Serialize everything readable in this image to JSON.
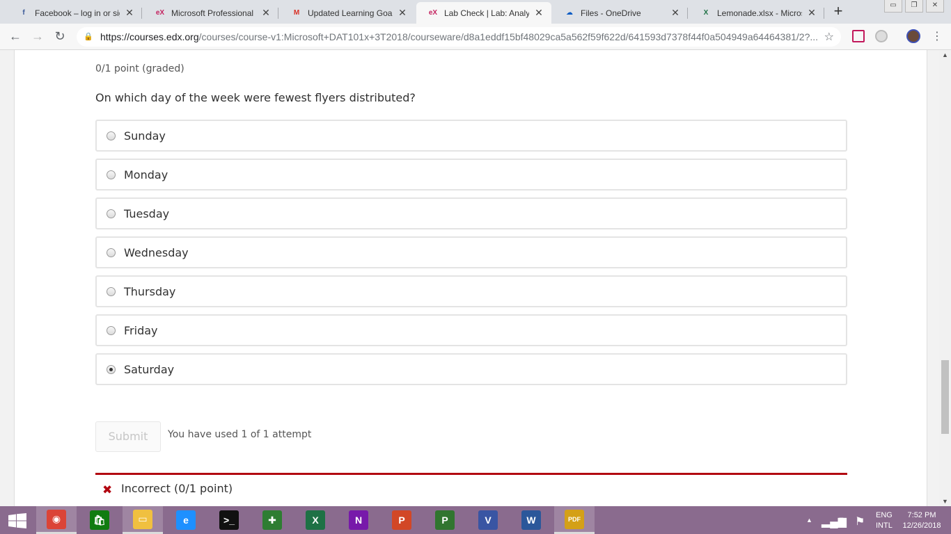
{
  "tabs": [
    {
      "title": "Facebook – log in or sign",
      "icon": "facebook-icon",
      "color": "#3b5998",
      "glyph": "f"
    },
    {
      "title": "Microsoft Professional Pr",
      "icon": "edx-icon",
      "color": "#c4225f",
      "glyph": "eX"
    },
    {
      "title": "Updated Learning Goals",
      "icon": "gmail-icon",
      "color": "#d93025",
      "glyph": "M"
    },
    {
      "title": "Lab Check | Lab: Analyzin",
      "icon": "edx-icon",
      "color": "#c4225f",
      "glyph": "eX"
    },
    {
      "title": "Files - OneDrive",
      "icon": "onedrive-icon",
      "color": "#0a5bc4",
      "glyph": "☁"
    },
    {
      "title": "Lemonade.xlsx - Microso",
      "icon": "excel-icon",
      "color": "#1e7145",
      "glyph": "X"
    }
  ],
  "url": {
    "host": "https://courses.edx.org",
    "path": "/courses/course-v1:Microsoft+DAT101x+3T2018/courseware/d8a1eddf15bf48029ca5a562f59f622d/641593d7378f44f0a504949a64464381/2?..."
  },
  "problem": {
    "grade": "0/1 point (graded)",
    "question": "On which day of the week were fewest flyers distributed?",
    "choices": [
      "Sunday",
      "Monday",
      "Tuesday",
      "Wednesday",
      "Thursday",
      "Friday",
      "Saturday"
    ],
    "selected": "Saturday",
    "submit_label": "Submit",
    "attempts": "You have used 1 of 1 attempt",
    "result_icon": "✖",
    "result": "Incorrect (0/1 point)"
  },
  "taskbar": {
    "apps": [
      {
        "name": "chrome",
        "glyph": "◉",
        "color": "#db4437",
        "open": true
      },
      {
        "name": "store",
        "glyph": "🛍",
        "color": "#107c10",
        "open": false
      },
      {
        "name": "file-explorer",
        "glyph": "▭",
        "color": "#f0c040",
        "open": true
      },
      {
        "name": "internet-explorer",
        "glyph": "e",
        "color": "#1e90ff",
        "open": false
      },
      {
        "name": "command-prompt",
        "glyph": ">_",
        "color": "#111111",
        "open": false
      },
      {
        "name": "medical-app",
        "glyph": "✚",
        "color": "#2e7d32",
        "open": false
      },
      {
        "name": "excel",
        "glyph": "X",
        "color": "#1e7145",
        "open": false
      },
      {
        "name": "onenote",
        "glyph": "N",
        "color": "#7719aa",
        "open": false
      },
      {
        "name": "powerpoint",
        "glyph": "P",
        "color": "#d24726",
        "open": false
      },
      {
        "name": "project",
        "glyph": "P",
        "color": "#31752f",
        "open": false
      },
      {
        "name": "visio",
        "glyph": "V",
        "color": "#3955a3",
        "open": false
      },
      {
        "name": "word",
        "glyph": "W",
        "color": "#2b579a",
        "open": false
      },
      {
        "name": "pdf",
        "glyph": "PDF",
        "color": "#d4a017",
        "open": true
      }
    ],
    "lang_line1": "ENG",
    "lang_line2": "INTL",
    "time": "7:52 PM",
    "date": "12/26/2018"
  }
}
